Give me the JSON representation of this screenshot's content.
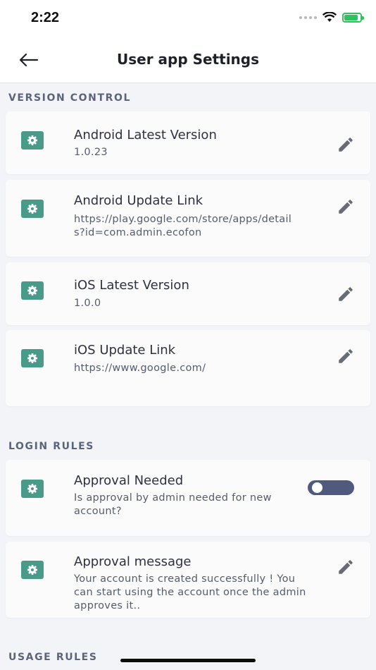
{
  "status_bar": {
    "time": "2:22"
  },
  "header": {
    "title": "User app Settings"
  },
  "sections": {
    "version_control": "VERSION CONTROL",
    "login_rules": "LOGIN RULES",
    "usage_rules": "USAGE RULES"
  },
  "items": [
    {
      "title": "Android Latest Version",
      "value": "1.0.23",
      "action": "edit"
    },
    {
      "title": "Android Update Link",
      "value": "https://play.google.com/store/apps/details?id=com.admin.ecofon",
      "action": "edit"
    },
    {
      "title": "iOS Latest Version",
      "value": "1.0.0",
      "action": "edit"
    },
    {
      "title": "iOS Update Link",
      "value": "https://www.google.com/",
      "action": "edit"
    },
    {
      "title": "Approval Needed",
      "value": "Is approval by admin needed for new account?",
      "action": "toggle",
      "toggle_on": false
    },
    {
      "title": "Approval message",
      "value": "Your account is created successfully ! You can start using the account once the admin approves it..",
      "action": "edit"
    }
  ],
  "colors": {
    "accent": "#4a9a8a",
    "toggle_track": "#4f5a7c",
    "background": "#f2f4f8"
  },
  "icons": {
    "back": "arrow-left-icon",
    "settings": "gear-icon",
    "edit": "pencil-icon",
    "wifi": "wifi-icon",
    "battery": "battery-charging-icon"
  }
}
